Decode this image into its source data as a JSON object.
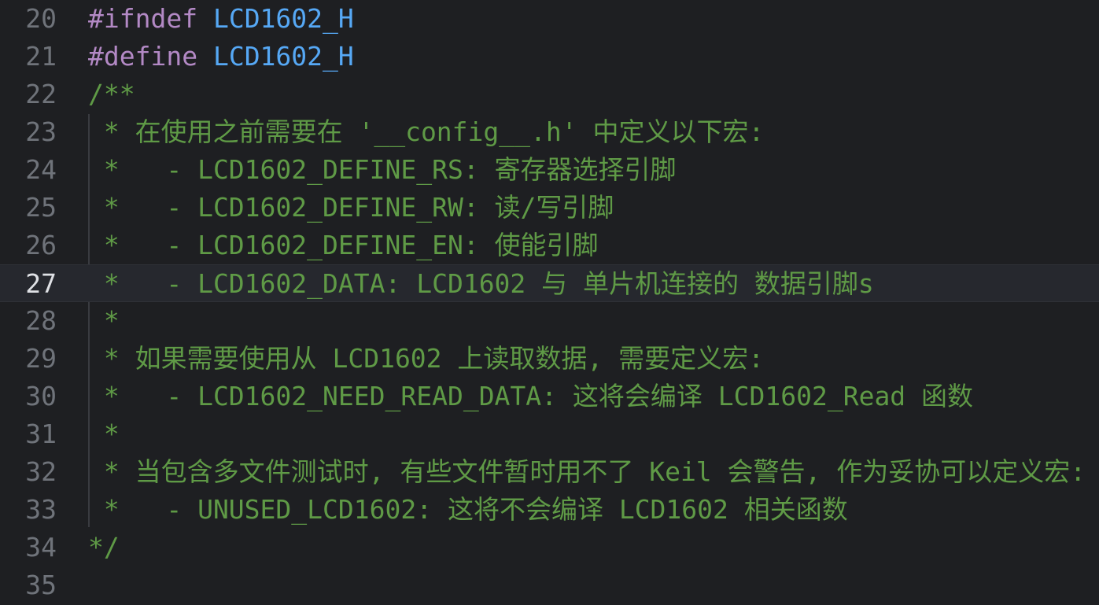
{
  "editor": {
    "lines": [
      {
        "num": "20",
        "parts": [
          {
            "cls": "kw-directive",
            "text": "#ifndef "
          },
          {
            "cls": "kw-macro",
            "text": "LCD1602_H"
          }
        ]
      },
      {
        "num": "21",
        "parts": [
          {
            "cls": "kw-directive",
            "text": "#define "
          },
          {
            "cls": "kw-macro",
            "text": "LCD1602_H"
          }
        ]
      },
      {
        "num": "22",
        "parts": [
          {
            "cls": "comment",
            "text": "/**"
          }
        ]
      },
      {
        "num": "23",
        "parts": [
          {
            "cls": "comment",
            "text": " * 在使用之前需要在 '__config__.h' 中定义以下宏:"
          }
        ]
      },
      {
        "num": "24",
        "parts": [
          {
            "cls": "comment",
            "text": " *   - LCD1602_DEFINE_RS: 寄存器选择引脚"
          }
        ]
      },
      {
        "num": "25",
        "parts": [
          {
            "cls": "comment",
            "text": " *   - LCD1602_DEFINE_RW: 读/写引脚"
          }
        ]
      },
      {
        "num": "26",
        "parts": [
          {
            "cls": "comment",
            "text": " *   - LCD1602_DEFINE_EN: 使能引脚"
          }
        ]
      },
      {
        "num": "27",
        "current": true,
        "parts": [
          {
            "cls": "comment",
            "text": " *   - LCD1602_DATA: LCD1602 与 单片机连接的 数据引脚s"
          }
        ]
      },
      {
        "num": "28",
        "parts": [
          {
            "cls": "comment",
            "text": " *"
          }
        ]
      },
      {
        "num": "29",
        "parts": [
          {
            "cls": "comment",
            "text": " * 如果需要使用从 LCD1602 上读取数据, 需要定义宏:"
          }
        ]
      },
      {
        "num": "30",
        "parts": [
          {
            "cls": "comment",
            "text": " *   - LCD1602_NEED_READ_DATA: 这将会编译 LCD1602_Read 函数"
          }
        ]
      },
      {
        "num": "31",
        "parts": [
          {
            "cls": "comment",
            "text": " *"
          }
        ]
      },
      {
        "num": "32",
        "parts": [
          {
            "cls": "comment",
            "text": " * 当包含多文件测试时, 有些文件暂时用不了 Keil 会警告, 作为妥协可以定义宏:"
          }
        ]
      },
      {
        "num": "33",
        "parts": [
          {
            "cls": "comment",
            "text": " *   - UNUSED_LCD1602: 这将不会编译 LCD1602 相关函数"
          }
        ]
      },
      {
        "num": "34",
        "parts": [
          {
            "cls": "comment",
            "text": "*/"
          }
        ]
      },
      {
        "num": "35",
        "parts": []
      }
    ],
    "colors": {
      "background": "#1e1f22",
      "line_number": "#6f737a",
      "line_number_current": "#dfe1e5",
      "directive": "#b389c5",
      "macro": "#56a8f5",
      "comment": "#5f9a46"
    }
  }
}
